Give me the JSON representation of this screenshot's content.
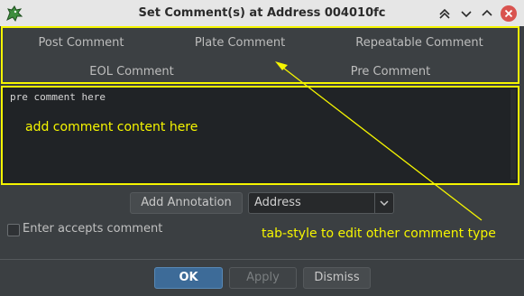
{
  "window": {
    "title": "Set Comment(s) at Address 004010fc"
  },
  "tabs": [
    {
      "label": "Post Comment"
    },
    {
      "label": "Plate Comment"
    },
    {
      "label": "Repeatable Comment"
    },
    {
      "label": "EOL Comment"
    },
    {
      "label": "Pre Comment"
    }
  ],
  "editor": {
    "content": "pre comment here"
  },
  "annotations": {
    "editor_note": "add comment  content here",
    "tab_note": "tab-style to edit other comment type",
    "color": "#f5f500"
  },
  "controls": {
    "add_annotation": "Add Annotation",
    "annotation_type": "Address",
    "enter_accepts": "Enter accepts comment",
    "enter_accepts_checked": false
  },
  "buttons": {
    "ok": "OK",
    "apply": "Apply",
    "dismiss": "Dismiss"
  },
  "icons": [
    "dragon-app-icon",
    "double-chevron-up-icon",
    "chevron-down-icon",
    "chevron-up-icon",
    "close-icon"
  ]
}
